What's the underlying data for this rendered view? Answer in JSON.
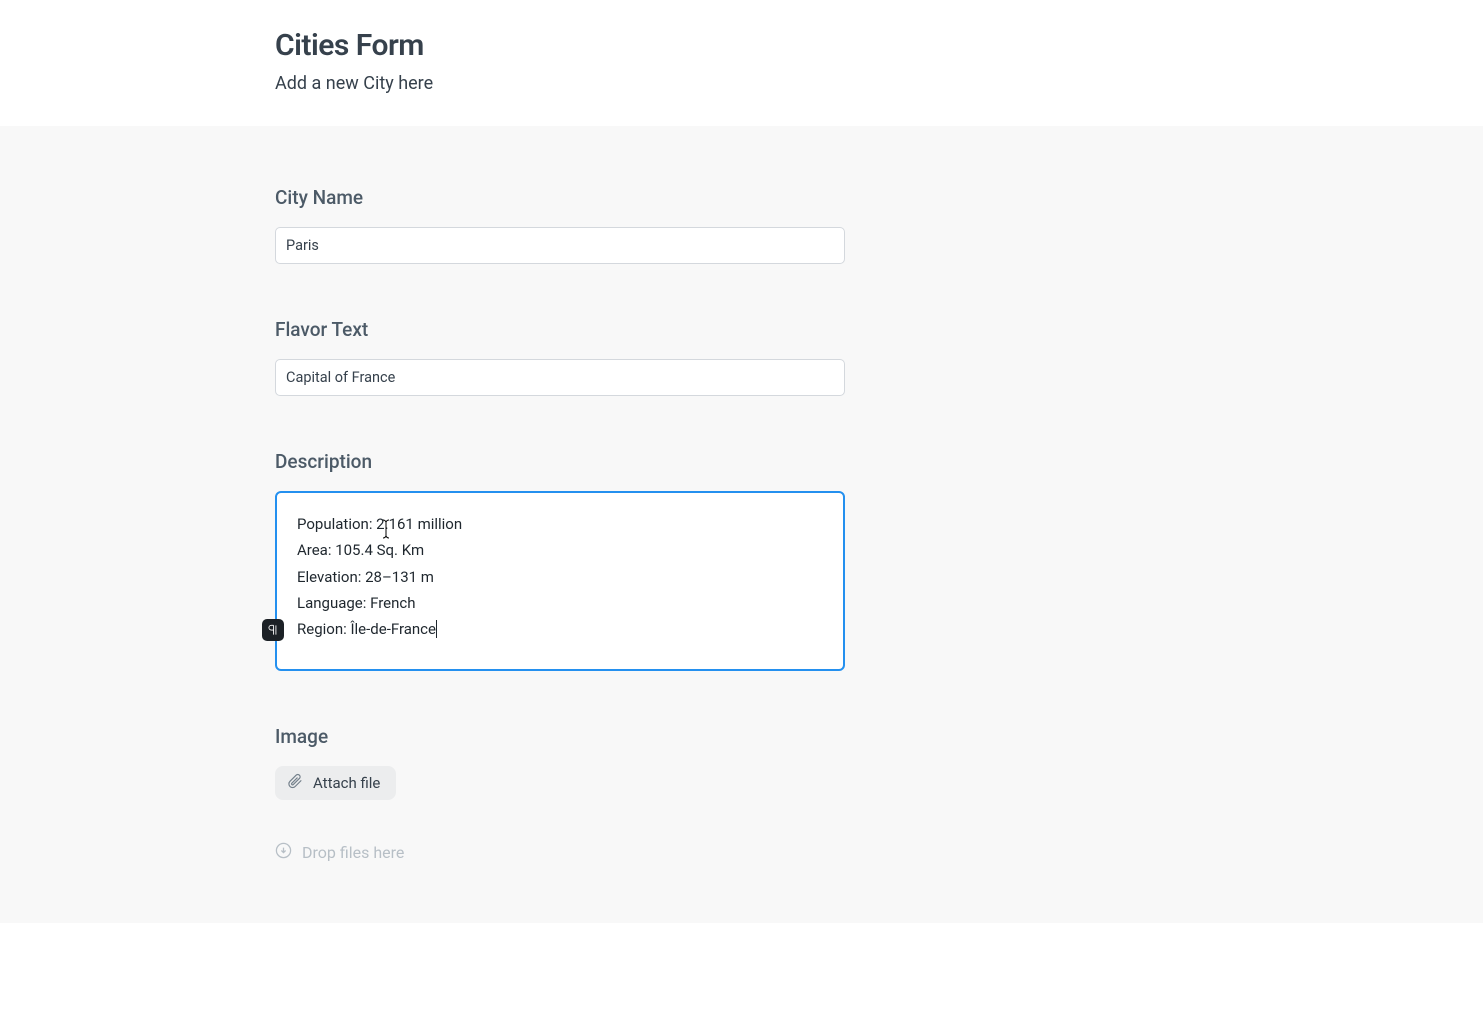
{
  "header": {
    "title": "Cities Form",
    "subtitle": "Add a new City here"
  },
  "fields": {
    "city_name": {
      "label": "City Name",
      "value": "Paris"
    },
    "flavor_text": {
      "label": "Flavor Text",
      "value": "Capital of France"
    },
    "description": {
      "label": "Description",
      "lines": [
        "Population: 2.161 million",
        "Area: 105.4 Sq. Km",
        "Elevation: 28–131 m",
        "Language: French",
        "Region: Île-de-France"
      ]
    },
    "image": {
      "label": "Image",
      "attach_label": "Attach file",
      "drop_hint": "Drop files here"
    }
  }
}
